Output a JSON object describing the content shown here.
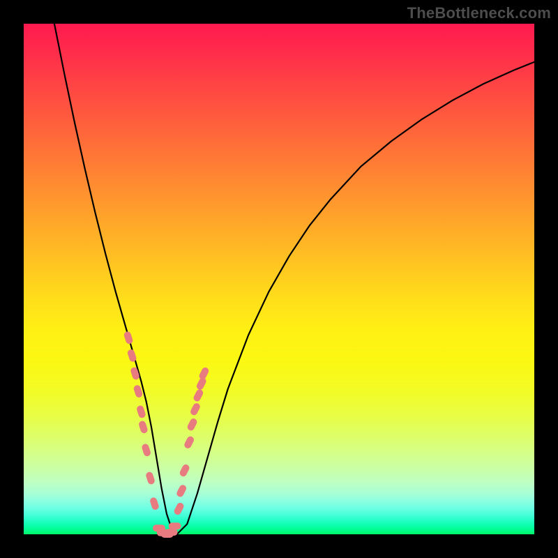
{
  "watermark": "TheBottleneck.com",
  "colors": {
    "frame": "#000000",
    "curve_stroke": "#000000",
    "marker_fill": "#e77b7f",
    "gradient_top": "#ff1a4f",
    "gradient_bottom": "#00f466"
  },
  "chart_data": {
    "type": "line",
    "title": "",
    "xlabel": "",
    "ylabel": "",
    "xlim": [
      0,
      100
    ],
    "ylim": [
      0,
      100
    ],
    "x": [
      6,
      8,
      10,
      12,
      14,
      16,
      18,
      20,
      21,
      22,
      23,
      24,
      25,
      26,
      27,
      28,
      29,
      30,
      32,
      34,
      36,
      38,
      40,
      44,
      48,
      52,
      56,
      60,
      66,
      72,
      78,
      84,
      90,
      96,
      100
    ],
    "y": [
      100,
      90,
      80.5,
      71.5,
      63,
      55,
      47.5,
      40.5,
      37,
      33.5,
      30,
      26,
      21,
      15,
      9,
      4,
      1,
      0,
      2,
      8,
      15,
      22,
      28.5,
      39,
      47.5,
      54.5,
      60.5,
      65.5,
      72,
      77,
      81.3,
      85,
      88.2,
      90.9,
      92.5
    ],
    "note": "V-shaped near-zero-minimum curve; y expressed as percent of plot height from bottom. Axes have no tick labels in the source image.",
    "series": [
      {
        "name": "markers-left-branch",
        "kind": "scatter",
        "x": [
          20.5,
          21.2,
          21.8,
          22.4,
          23.0,
          23.4,
          24.0,
          24.8,
          25.6
        ],
        "y": [
          38.5,
          35.0,
          31.5,
          28.0,
          24.0,
          21.0,
          16.5,
          11.0,
          6.0
        ]
      },
      {
        "name": "markers-right-branch",
        "kind": "scatter",
        "x": [
          30.4,
          30.9,
          31.5,
          32.4,
          33.0,
          33.6,
          34.2,
          34.8,
          35.3
        ],
        "y": [
          5.0,
          8.5,
          12.5,
          18.0,
          21.5,
          24.5,
          27.2,
          29.5,
          31.5
        ]
      },
      {
        "name": "markers-valley",
        "kind": "scatter",
        "x": [
          26.5,
          27.3,
          28.1,
          28.9,
          29.6
        ],
        "y": [
          1.2,
          0.3,
          0.0,
          0.4,
          1.6
        ]
      }
    ]
  }
}
